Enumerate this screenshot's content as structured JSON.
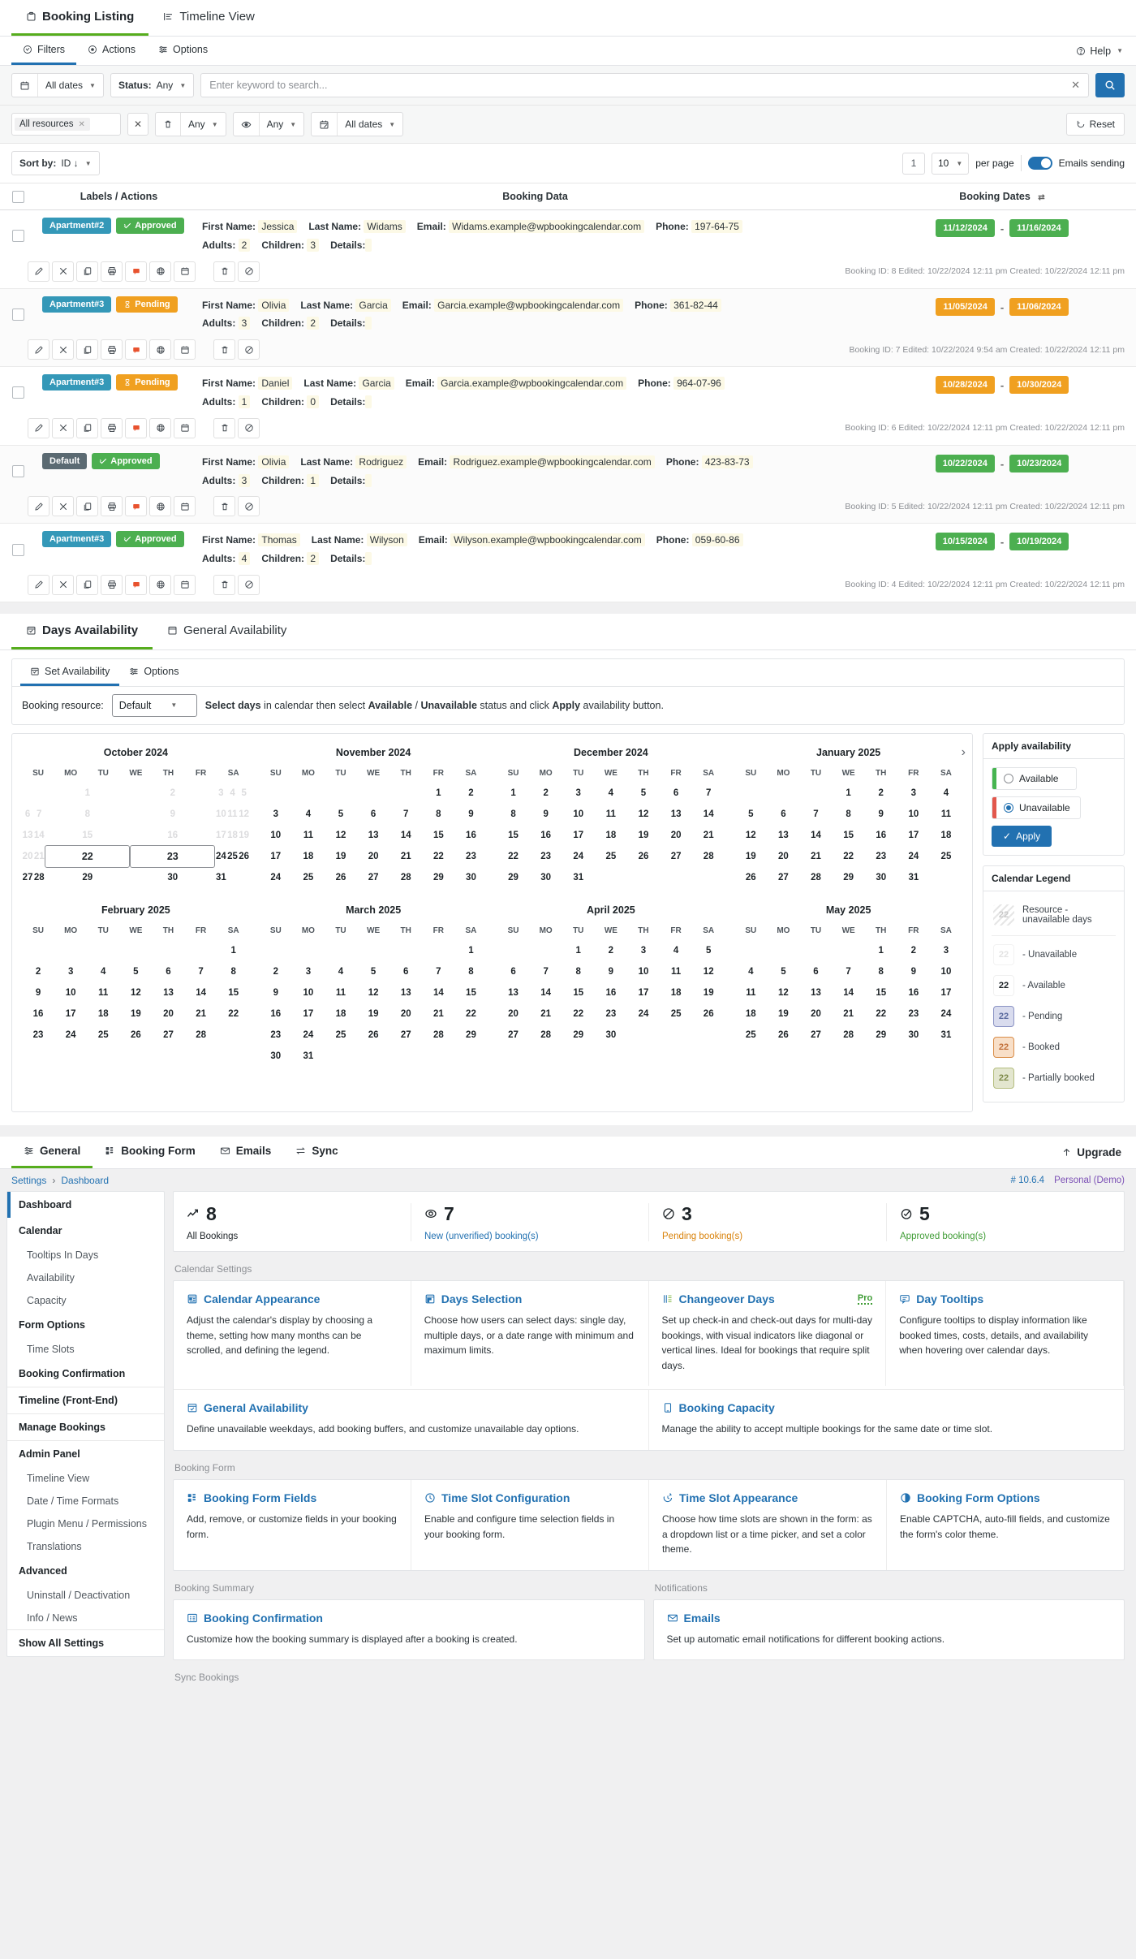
{
  "top_tabs": [
    {
      "label": "Booking Listing",
      "icon": "clipboard-icon",
      "active": true
    },
    {
      "label": "Timeline View",
      "icon": "timeline-icon",
      "active": false
    }
  ],
  "listing": {
    "subtabs": [
      {
        "label": "Filters",
        "icon": "filter-icon",
        "active": true
      },
      {
        "label": "Actions",
        "icon": "actions-icon",
        "active": false
      },
      {
        "label": "Options",
        "icon": "sliders-icon",
        "active": false
      }
    ],
    "help_label": "Help",
    "filters": {
      "date_filter": "All dates",
      "status_label": "Status:",
      "status_value": "Any",
      "search_placeholder": "Enter keyword to search...",
      "search_value": "",
      "resource_chip": "All resources",
      "trash_value": "Any",
      "approved_value": "Any",
      "created_value": "All dates",
      "reset_label": "Reset"
    },
    "sort": {
      "label": "Sort by:",
      "value": "ID ↓",
      "page_number": "1",
      "per_page_value": "10",
      "per_page_label": "per page",
      "emails_label": "Emails sending"
    },
    "table_headers": {
      "labels": "Labels / Actions",
      "data": "Booking Data",
      "dates": "Booking Dates"
    },
    "field_labels": {
      "first_name": "First Name:",
      "last_name": "Last Name:",
      "email": "Email:",
      "phone": "Phone:",
      "adults": "Adults:",
      "children": "Children:",
      "details": "Details:"
    },
    "rows": [
      {
        "resource": "Apartment#2",
        "resource_style": "bg-res",
        "status": "Approved",
        "status_style": "bg-appr",
        "status_icon": "check",
        "first_name": "Jessica",
        "last_name": "Widams",
        "email": "Widams.example@wpbookingcalendar.com",
        "phone": "197-64-75",
        "adults": "2",
        "children": "3",
        "details": "",
        "date_from": "11/12/2024",
        "date_to": "11/16/2024",
        "date_style": "d-green",
        "meta": "Booking ID: 8  Edited: 10/22/2024 12:11 pm  Created: 10/22/2024 12:11 pm"
      },
      {
        "resource": "Apartment#3",
        "resource_style": "bg-res",
        "status": "Pending",
        "status_style": "bg-pend",
        "status_icon": "hourglass",
        "first_name": "Olivia",
        "last_name": "Garcia",
        "email": "Garcia.example@wpbookingcalendar.com",
        "phone": "361-82-44",
        "adults": "3",
        "children": "2",
        "details": "",
        "date_from": "11/05/2024",
        "date_to": "11/06/2024",
        "date_style": "d-orange",
        "meta": "Booking ID: 7  Edited: 10/22/2024 9:54 am  Created: 10/22/2024 12:11 pm"
      },
      {
        "resource": "Apartment#3",
        "resource_style": "bg-res",
        "status": "Pending",
        "status_style": "bg-pend",
        "status_icon": "hourglass",
        "first_name": "Daniel",
        "last_name": "Garcia",
        "email": "Garcia.example@wpbookingcalendar.com",
        "phone": "964-07-96",
        "adults": "1",
        "children": "0",
        "details": "",
        "date_from": "10/28/2024",
        "date_to": "10/30/2024",
        "date_style": "d-orange",
        "meta": "Booking ID: 6  Edited: 10/22/2024 12:11 pm  Created: 10/22/2024 12:11 pm"
      },
      {
        "resource": "Default",
        "resource_style": "bg-res-default",
        "status": "Approved",
        "status_style": "bg-appr",
        "status_icon": "check",
        "first_name": "Olivia",
        "last_name": "Rodriguez",
        "email": "Rodriguez.example@wpbookingcalendar.com",
        "phone": "423-83-73",
        "adults": "3",
        "children": "1",
        "details": "",
        "date_from": "10/22/2024",
        "date_to": "10/23/2024",
        "date_style": "d-green",
        "meta": "Booking ID: 5  Edited: 10/22/2024 12:11 pm  Created: 10/22/2024 12:11 pm"
      },
      {
        "resource": "Apartment#3",
        "resource_style": "bg-res",
        "status": "Approved",
        "status_style": "bg-appr",
        "status_icon": "check",
        "first_name": "Thomas",
        "last_name": "Wilyson",
        "email": "Wilyson.example@wpbookingcalendar.com",
        "phone": "059-60-86",
        "adults": "4",
        "children": "2",
        "details": "",
        "date_from": "10/15/2024",
        "date_to": "10/19/2024",
        "date_style": "d-green",
        "meta": "Booking ID: 4  Edited: 10/22/2024 12:11 pm  Created: 10/22/2024 12:11 pm"
      }
    ]
  },
  "availability": {
    "tabs": [
      {
        "label": "Days Availability",
        "icon": "calendar-check-icon",
        "active": true
      },
      {
        "label": "General Availability",
        "icon": "calendar-icon",
        "active": false
      }
    ],
    "sub_tabs": [
      {
        "label": "Set Availability",
        "icon": "calendar-check-icon",
        "active": true
      },
      {
        "label": "Options",
        "icon": "sliders-icon",
        "active": false
      }
    ],
    "resource_label": "Booking resource:",
    "resource_value": "Default",
    "hint": {
      "p1": "Select days",
      "p2": " in calendar then select ",
      "p3": "Available",
      "p4": " / ",
      "p5": "Unavailable",
      "p6": " status and click ",
      "p7": "Apply",
      "p8": " availability button."
    },
    "dow": [
      "SU",
      "MO",
      "TU",
      "WE",
      "TH",
      "FR",
      "SA"
    ],
    "months": [
      {
        "title": "October 2024",
        "lead": 2,
        "out_end": 21,
        "days": 31,
        "selected": [
          22,
          23
        ]
      },
      {
        "title": "November 2024",
        "lead": 5,
        "out_end": 0,
        "days": 30,
        "selected": []
      },
      {
        "title": "December 2024",
        "lead": 0,
        "out_end": 0,
        "days": 31,
        "selected": []
      },
      {
        "title": "January 2025",
        "lead": 3,
        "out_end": 0,
        "days": 31,
        "selected": []
      },
      {
        "title": "February 2025",
        "lead": 6,
        "out_end": 0,
        "days": 28,
        "selected": []
      },
      {
        "title": "March 2025",
        "lead": 6,
        "out_end": 0,
        "days": 31,
        "selected": []
      },
      {
        "title": "April 2025",
        "lead": 2,
        "out_end": 0,
        "days": 30,
        "selected": []
      },
      {
        "title": "May 2025",
        "lead": 4,
        "out_end": 0,
        "days": 31,
        "selected": []
      }
    ],
    "apply_card": {
      "title": "Apply availability",
      "available_label": "Available",
      "unavailable_label": "Unavailable",
      "selected": "Unavailable",
      "apply_label": "Apply"
    },
    "legend": {
      "title": "Calendar Legend",
      "items": [
        {
          "sample": "22",
          "text": "Resource - unavailable days",
          "style": "lg-hatch"
        },
        {
          "sample": "22",
          "text": "- Unavailable",
          "style": "lg-unav"
        },
        {
          "sample": "22",
          "text": "- Available",
          "style": "lg-av"
        },
        {
          "sample": "22",
          "text": "- Pending",
          "style": "lg-pend"
        },
        {
          "sample": "22",
          "text": "- Booked",
          "style": "lg-book"
        },
        {
          "sample": "22",
          "text": "- Partially booked",
          "style": "lg-part"
        }
      ]
    }
  },
  "settings": {
    "tabs": [
      {
        "label": "General",
        "icon": "sliders-icon",
        "active": true
      },
      {
        "label": "Booking Form",
        "icon": "grid-icon",
        "active": false
      },
      {
        "label": "Emails",
        "icon": "mail-icon",
        "active": false
      },
      {
        "label": "Sync",
        "icon": "sync-icon",
        "active": false
      }
    ],
    "upgrade_label": "Upgrade",
    "breadcrumb": {
      "root": "Settings",
      "sep": "›",
      "current": "Dashboard"
    },
    "version": "# 10.6.4",
    "license": "Personal (Demo)",
    "sidebar": [
      {
        "label": "Dashboard",
        "type": "item",
        "active": true
      },
      {
        "label": "Calendar",
        "type": "item"
      },
      {
        "label": "Tooltips In Days",
        "type": "sub"
      },
      {
        "label": "Availability",
        "type": "sub"
      },
      {
        "label": "Capacity",
        "type": "sub"
      },
      {
        "label": "Form Options",
        "type": "item"
      },
      {
        "label": "Time Slots",
        "type": "sub"
      },
      {
        "label": "Booking Confirmation",
        "type": "item",
        "divider_after": true
      },
      {
        "label": "Timeline (Front-End)",
        "type": "item",
        "divider_after": true
      },
      {
        "label": "Manage Bookings",
        "type": "item",
        "divider_after": true
      },
      {
        "label": "Admin Panel",
        "type": "item"
      },
      {
        "label": "Timeline View",
        "type": "sub"
      },
      {
        "label": "Date / Time Formats",
        "type": "sub"
      },
      {
        "label": "Plugin Menu / Permissions",
        "type": "sub"
      },
      {
        "label": "Translations",
        "type": "sub"
      },
      {
        "label": "Advanced",
        "type": "item"
      },
      {
        "label": "Uninstall / Deactivation",
        "type": "sub"
      },
      {
        "label": "Info / News",
        "type": "sub",
        "divider_after": true
      },
      {
        "label": "Show All Settings",
        "type": "item"
      }
    ],
    "stats": [
      {
        "value": "8",
        "label": "All Bookings",
        "color": "c-dark",
        "icon": "trend-up-icon"
      },
      {
        "value": "7",
        "label": "New (unverified) booking(s)",
        "color": "c-blue",
        "icon": "eye-icon"
      },
      {
        "value": "3",
        "label": "Pending booking(s)",
        "color": "c-orange",
        "icon": "clock-slash-icon"
      },
      {
        "value": "5",
        "label": "Approved booking(s)",
        "color": "c-green",
        "icon": "check-circle-icon"
      }
    ],
    "groups": [
      {
        "title": "Calendar Settings",
        "rows": [
          [
            {
              "title": "Calendar Appearance",
              "icon": "calendar-appearance-icon",
              "desc": "Adjust the calendar's display by choosing a theme, setting how many months can be scrolled, and defining the legend."
            },
            {
              "title": "Days Selection",
              "icon": "days-selection-icon",
              "desc": "Choose how users can select days: single day, multiple days, or a date range with minimum and maximum limits."
            },
            {
              "title": "Changeover Days",
              "icon": "changeover-icon",
              "badge": "Pro",
              "desc": "Set up check-in and check-out days for multi-day bookings, with visual indicators like diagonal or vertical lines. Ideal for bookings that require split days."
            },
            {
              "title": "Day Tooltips",
              "icon": "tooltip-icon",
              "desc": "Configure tooltips to display information like booked times, costs, details, and availability when hovering over calendar days."
            }
          ],
          [
            {
              "title": "General Availability",
              "icon": "calendar-check-icon",
              "half": true,
              "desc": "Define unavailable weekdays, add booking buffers, and customize unavailable day options."
            },
            {
              "title": "Booking Capacity",
              "icon": "capacity-icon",
              "half": true,
              "desc": "Manage the ability to accept multiple bookings for the same date or time slot."
            }
          ]
        ]
      },
      {
        "title": "Booking Form",
        "rows": [
          [
            {
              "title": "Booking Form Fields",
              "icon": "grid-icon",
              "desc": "Add, remove, or customize fields in your booking form."
            },
            {
              "title": "Time Slot Configuration",
              "icon": "clock-icon",
              "desc": "Enable and configure time selection fields in your booking form."
            },
            {
              "title": "Time Slot Appearance",
              "icon": "clock-arrow-icon",
              "desc": "Choose how time slots are shown in the form: as a dropdown list or a time picker, and set a color theme."
            },
            {
              "title": "Booking Form Options",
              "icon": "contrast-icon",
              "desc": "Enable CAPTCHA, auto-fill fields, and customize the form's color theme."
            }
          ]
        ]
      }
    ],
    "summary_group_title": "Booking Summary",
    "notifications_group_title": "Notifications",
    "summary_card": {
      "title": "Booking Confirmation",
      "icon": "confirmation-icon",
      "desc": "Customize how the booking summary is displayed after a booking is created."
    },
    "notifications_card": {
      "title": "Emails",
      "icon": "mail-icon",
      "desc": "Set up automatic email notifications for different booking actions."
    },
    "sync_group_title": "Sync Bookings"
  }
}
